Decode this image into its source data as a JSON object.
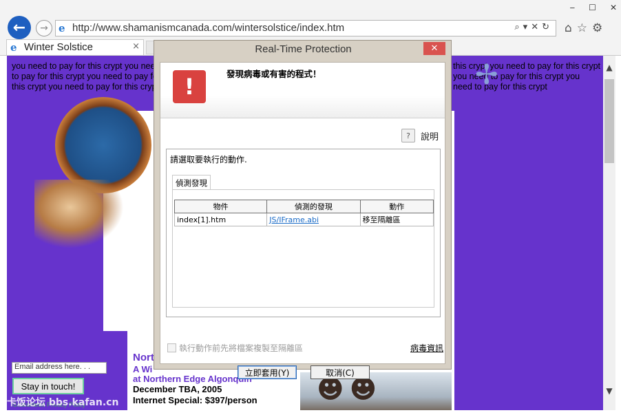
{
  "browser": {
    "address": "http://www.shamanismcanada.com/wintersolstice/index.htm",
    "tab_title": "Winter Solstice",
    "tab_close": "×",
    "back_glyph": "←",
    "forward_glyph": "→",
    "ie_glyph": "e",
    "address_tools": "⌕▾✕↻",
    "nav_icons": "⌂☆⚙",
    "window_buttons": [
      "‒",
      "☐",
      "✕"
    ]
  },
  "page": {
    "crypt_text_left": "you need to pay for this crypt you need to pay for this crypt you need to pay for this crypt you need to pay for this crypt",
    "crypt_text_right": "this crypt you need to pay for this crypt you need to pay for this crypt you need to pay for this crypt",
    "email_placeholder": "Email address here. . .",
    "stay_button": "Stay in touch!",
    "guarantee": "Guaranteed Privacy Policy",
    "event_title": "Nort",
    "event_sub1": "A Wi",
    "event_sub2": "at Northern Edge Algonquin",
    "event_date": "December TBA, 2005",
    "event_price": "Internet Special: $397/person",
    "watermark": "卡饭论坛 bbs.kafan.cn",
    "accent_color": "#6633cc"
  },
  "scrollbar": {
    "up": "▲",
    "down": "▼"
  },
  "dialog": {
    "title": "Real-Time Protection",
    "close_glyph": "✕",
    "alert_glyph": "!",
    "alert_message": "發現病毒或有害的程式！",
    "help_glyph": "?",
    "help_label": "說明",
    "action_prompt": "請選取要執行的動作.",
    "detection_tab": "偵測發現",
    "table": {
      "headers": [
        "物件",
        "偵測的發現",
        "動作"
      ],
      "rows": [
        {
          "object": "index[1].htm",
          "finding": "JS/IFrame.abi",
          "action": "移至隔離區"
        }
      ]
    },
    "copy_option": "執行動作前先將檔案複製至隔離區",
    "virus_info": "病毒資訊",
    "apply_button": "立即套用(Y)",
    "cancel_button": "取消(C)"
  }
}
